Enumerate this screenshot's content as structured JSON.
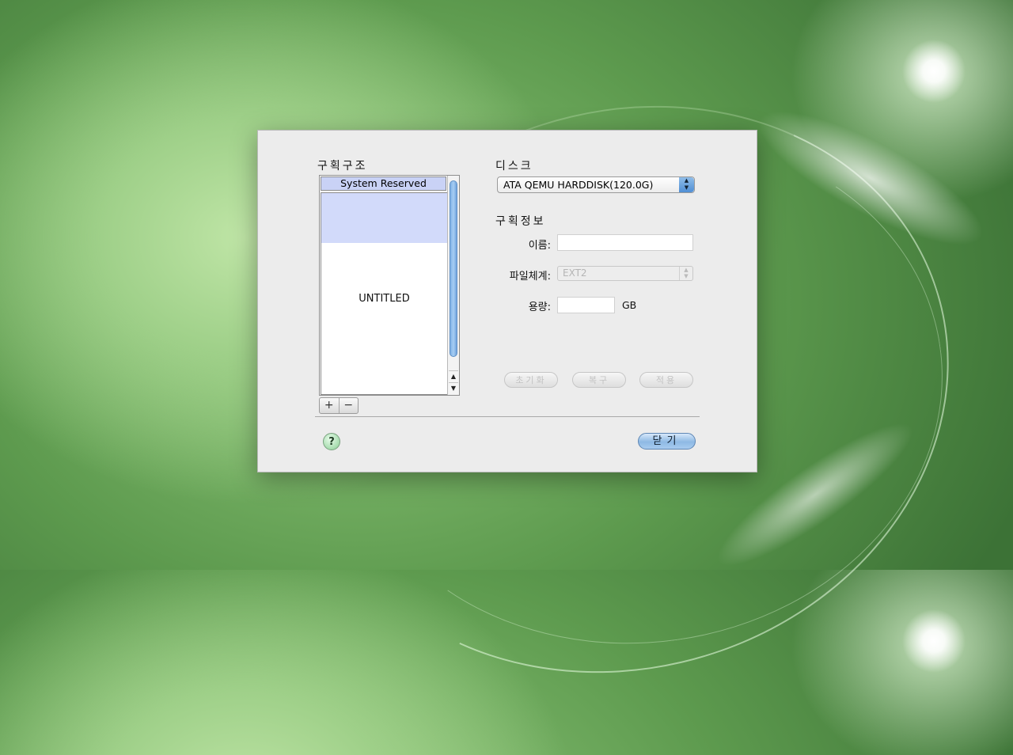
{
  "dialog": {
    "partition_structure_label": "구획구조",
    "disk_label": "디스크",
    "partition_info_label": "구획정보"
  },
  "partition_list": {
    "items": [
      {
        "label": "System Reserved"
      },
      {
        "label": "UNTITLED"
      }
    ],
    "add_label": "+",
    "remove_label": "−"
  },
  "disk": {
    "selected": "ATA QEMU HARDDISK(120.0G)"
  },
  "fields": {
    "name_label": "이름:",
    "name_value": "",
    "filesystem_label": "파일체계:",
    "filesystem_value": "EXT2",
    "size_label": "용량:",
    "size_value": "",
    "size_unit": "GB"
  },
  "actions": {
    "initialize_label": "초기화",
    "restore_label": "복구",
    "apply_label": "적용"
  },
  "footer": {
    "help_label": "?",
    "close_label": "닫기"
  },
  "colors": {
    "desktop_green": "#5d9a4e",
    "selection_blue": "#d2dafa",
    "accent_blue": "#8eb9e4"
  }
}
